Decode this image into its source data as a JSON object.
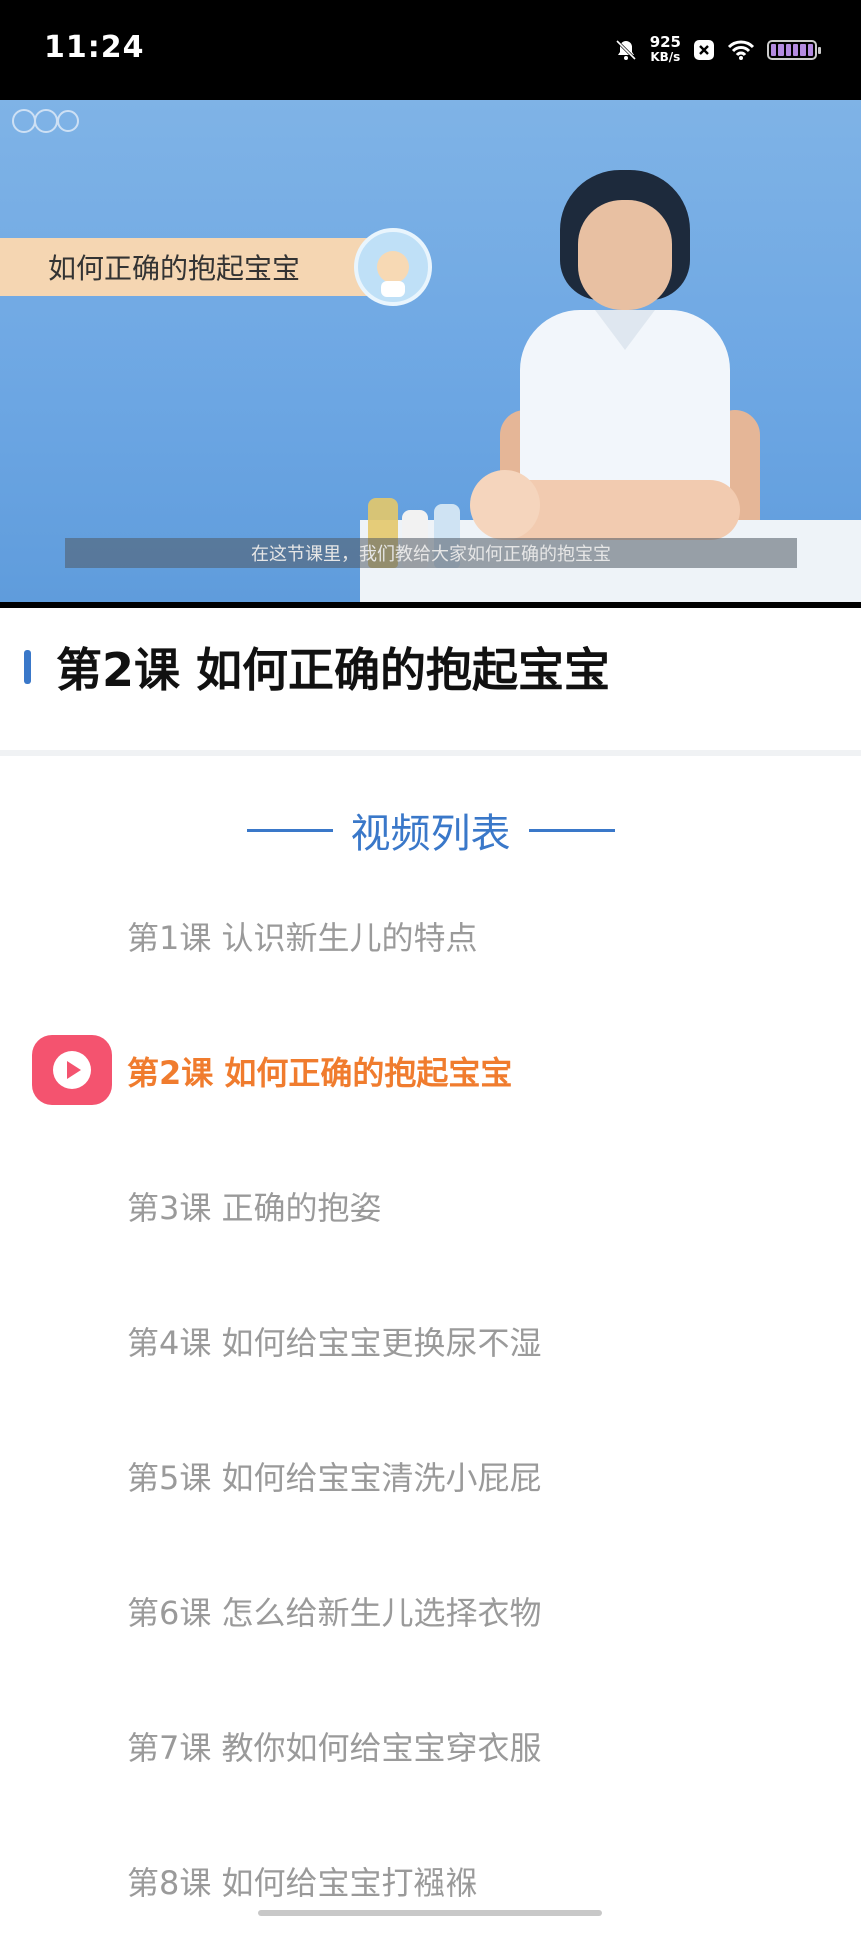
{
  "status_bar": {
    "time": "11:24",
    "net_speed_value": "925",
    "net_speed_unit": "KB/s",
    "icons": [
      "bell-muted-icon",
      "close-box-icon",
      "wifi-icon",
      "battery-icon"
    ]
  },
  "video": {
    "banner_text": "如何正确的抱起宝宝",
    "subtitle": "在这节课里，我们教给大家如何正确的抱宝宝"
  },
  "lesson": {
    "title": "第2课 如何正确的抱起宝宝"
  },
  "playlist": {
    "heading": "视频列表",
    "items": [
      {
        "label": "第1课 认识新生儿的特点",
        "active": false
      },
      {
        "label": "第2课 如何正确的抱起宝宝",
        "active": true
      },
      {
        "label": "第3课 正确的抱姿",
        "active": false
      },
      {
        "label": "第4课 如何给宝宝更换尿不湿",
        "active": false
      },
      {
        "label": "第5课 如何给宝宝清洗小屁屁",
        "active": false
      },
      {
        "label": "第6课 怎么给新生儿选择衣物",
        "active": false
      },
      {
        "label": "第7课 教你如何给宝宝穿衣服",
        "active": false
      },
      {
        "label": "第8课 如何给宝宝打襁褓",
        "active": false
      }
    ]
  },
  "colors": {
    "accent_blue": "#3a78c9",
    "active_orange": "#f07c2e",
    "play_icon_red": "#f4536f",
    "inactive_gray": "#9a9a9a"
  }
}
